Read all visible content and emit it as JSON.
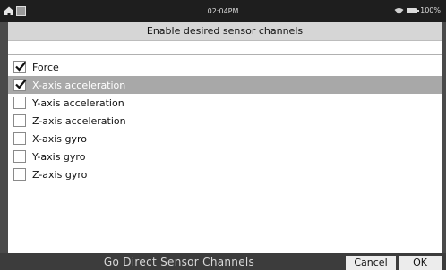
{
  "status_bar": {
    "time": "02:04PM",
    "battery": "100%",
    "icons": [
      "home-icon",
      "app-square-icon",
      "wifi-icon",
      "battery-icon"
    ]
  },
  "dialog": {
    "title": "Enable desired sensor channels",
    "channels": [
      {
        "label": "Force",
        "checked": true,
        "selected": false
      },
      {
        "label": "X-axis acceleration",
        "checked": true,
        "selected": true
      },
      {
        "label": "Y-axis acceleration",
        "checked": false,
        "selected": false
      },
      {
        "label": "Z-axis acceleration",
        "checked": false,
        "selected": false
      },
      {
        "label": "X-axis gyro",
        "checked": false,
        "selected": false
      },
      {
        "label": "Y-axis gyro",
        "checked": false,
        "selected": false
      },
      {
        "label": "Z-axis gyro",
        "checked": false,
        "selected": false
      }
    ]
  },
  "bottom_bar": {
    "app_title": "Go Direct Sensor Channels",
    "cancel_label": "Cancel",
    "ok_label": "OK"
  },
  "colors": {
    "selected_row": "#a8a8a8",
    "status_bar": "#1e1e1e",
    "bottom_bar": "#3c3c3c"
  }
}
